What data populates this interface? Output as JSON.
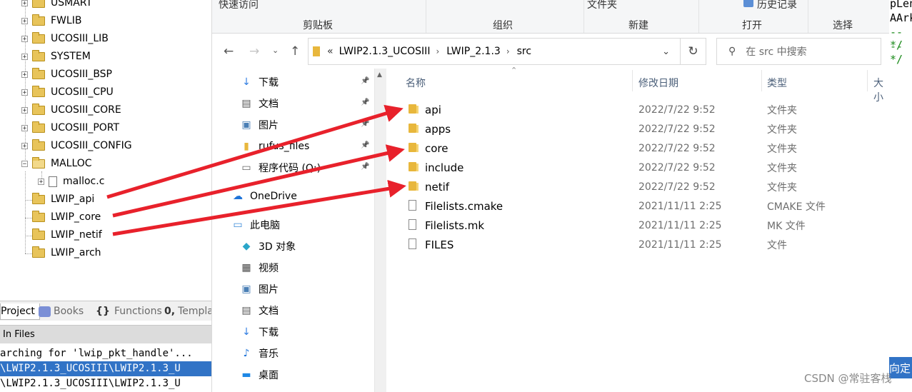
{
  "ide": {
    "tree": [
      {
        "label": "USMART",
        "expand": "+",
        "open": false
      },
      {
        "label": "FWLIB",
        "expand": "+",
        "open": false
      },
      {
        "label": "UCOSIII_LIB",
        "expand": "+",
        "open": false
      },
      {
        "label": "SYSTEM",
        "expand": "+",
        "open": false
      },
      {
        "label": "UCOSIII_BSP",
        "expand": "+",
        "open": false
      },
      {
        "label": "UCOSIII_CPU",
        "expand": "+",
        "open": false
      },
      {
        "label": "UCOSIII_CORE",
        "expand": "+",
        "open": false
      },
      {
        "label": "UCOSIII_PORT",
        "expand": "+",
        "open": false
      },
      {
        "label": "UCOSIII_CONFIG",
        "expand": "+",
        "open": false
      },
      {
        "label": "MALLOC",
        "expand": "−",
        "open": true
      },
      {
        "label": "malloc.c",
        "expand": "+",
        "open": false,
        "file": true
      },
      {
        "label": "LWIP_api",
        "expand": "",
        "open": false
      },
      {
        "label": "LWIP_core",
        "expand": "",
        "open": false
      },
      {
        "label": "LWIP_netif",
        "expand": "",
        "open": false
      },
      {
        "label": "LWIP_arch",
        "expand": "",
        "open": false
      }
    ],
    "tabs": {
      "project": "Project",
      "books": "Books",
      "functions": "Functions",
      "templates": "Templa"
    },
    "find_title": "In Files",
    "console": [
      "arching for 'lwip_pkt_handle'...",
      "\\LWIP2.1.3_UCOSIII\\LWIP2.1.3_U",
      "\\LWIP2.1.3_UCOSIII\\LWIP2.1.3_U"
    ],
    "code_right": [
      "pLen",
      "AArk",
      "--*/",
      "--*/"
    ],
    "code_right_bottom": "向定"
  },
  "explorer": {
    "ribbon": {
      "top_labels": {
        "quick_access": "快速访问",
        "folder": "文件夹",
        "history": "历史记录"
      },
      "groups": [
        "剪贴板",
        "组织",
        "新建",
        "打开",
        "选择"
      ]
    },
    "breadcrumb": {
      "overflow": "«",
      "parts": [
        "LWIP2.1.3_UCOSIII",
        "LWIP_2.1.3",
        "src"
      ]
    },
    "search_placeholder": "在 src 中搜索",
    "nav_items": [
      {
        "label": "下载",
        "icon": "download-icon",
        "pinned": true
      },
      {
        "label": "文档",
        "icon": "document-icon",
        "pinned": true
      },
      {
        "label": "图片",
        "icon": "picture-icon",
        "pinned": true
      },
      {
        "label": "rufus_files",
        "icon": "folder-icon",
        "pinned": true
      },
      {
        "label": "程序代码 (Q:)",
        "icon": "drive-icon",
        "pinned": true
      },
      {
        "label": "OneDrive",
        "icon": "onedrive-icon",
        "pinned": false
      },
      {
        "label": "此电脑",
        "icon": "computer-icon",
        "pinned": false
      },
      {
        "label": "3D 对象",
        "icon": "3d-objects-icon",
        "pinned": false
      },
      {
        "label": "视频",
        "icon": "video-icon",
        "pinned": false
      },
      {
        "label": "图片",
        "icon": "picture-icon",
        "pinned": false
      },
      {
        "label": "文档",
        "icon": "document-icon",
        "pinned": false
      },
      {
        "label": "下载",
        "icon": "download-icon",
        "pinned": false
      },
      {
        "label": "音乐",
        "icon": "music-icon",
        "pinned": false
      },
      {
        "label": "桌面",
        "icon": "desktop-icon",
        "pinned": false
      }
    ],
    "columns": {
      "name": "名称",
      "date": "修改日期",
      "type": "类型",
      "size": "大小"
    },
    "files": [
      {
        "name": "api",
        "date": "2022/7/22 9:52",
        "type": "文件夹",
        "kind": "folder"
      },
      {
        "name": "apps",
        "date": "2022/7/22 9:52",
        "type": "文件夹",
        "kind": "folder"
      },
      {
        "name": "core",
        "date": "2022/7/22 9:52",
        "type": "文件夹",
        "kind": "folder"
      },
      {
        "name": "include",
        "date": "2022/7/22 9:52",
        "type": "文件夹",
        "kind": "folder"
      },
      {
        "name": "netif",
        "date": "2022/7/22 9:52",
        "type": "文件夹",
        "kind": "folder"
      },
      {
        "name": "Filelists.cmake",
        "date": "2021/11/11 2:25",
        "type": "CMAKE 文件",
        "kind": "file"
      },
      {
        "name": "Filelists.mk",
        "date": "2021/11/11 2:25",
        "type": "MK 文件",
        "kind": "file"
      },
      {
        "name": "FILES",
        "date": "2021/11/11 2:25",
        "type": "文件",
        "kind": "file"
      }
    ]
  },
  "watermark": "CSDN @常驻客栈",
  "colors": {
    "arrow": "#e8212b",
    "selection": "#3173c6",
    "folder": "#e8b73c"
  }
}
